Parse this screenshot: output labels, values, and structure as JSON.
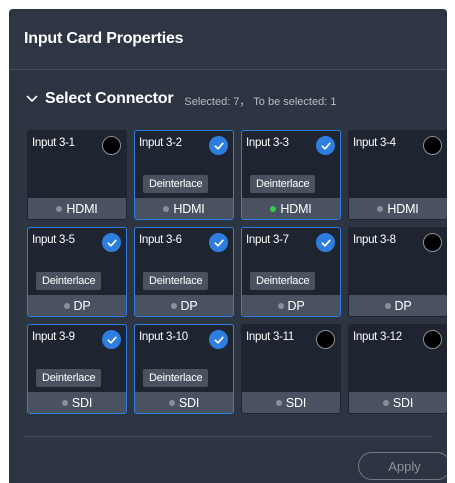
{
  "panel": {
    "title": "Input Card Properties"
  },
  "section": {
    "title": "Select Connector",
    "meta": "Selected: 7， To be selected: 1"
  },
  "colors": {
    "accent": "#2e7de0",
    "active_dot": "#2bd14c",
    "inactive_dot": "#8a909a"
  },
  "cards": [
    {
      "name": "Input 3-1",
      "selected": false,
      "tag": "",
      "type": "HDMI",
      "active": false
    },
    {
      "name": "Input 3-2",
      "selected": true,
      "tag": "Deinterlace",
      "type": "HDMI",
      "active": false
    },
    {
      "name": "Input 3-3",
      "selected": true,
      "tag": "Deinterlace",
      "type": "HDMI",
      "active": true
    },
    {
      "name": "Input 3-4",
      "selected": false,
      "tag": "",
      "type": "HDMI",
      "active": false
    },
    {
      "name": "Input 3-5",
      "selected": true,
      "tag": "Deinterlace",
      "type": "DP",
      "active": false
    },
    {
      "name": "Input 3-6",
      "selected": true,
      "tag": "Deinterlace",
      "type": "DP",
      "active": false
    },
    {
      "name": "Input 3-7",
      "selected": true,
      "tag": "Deinterlace",
      "type": "DP",
      "active": false
    },
    {
      "name": "Input 3-8",
      "selected": false,
      "tag": "",
      "type": "DP",
      "active": false
    },
    {
      "name": "Input 3-9",
      "selected": true,
      "tag": "Deinterlace",
      "type": "SDI",
      "active": false
    },
    {
      "name": "Input 3-10",
      "selected": true,
      "tag": "Deinterlace",
      "type": "SDI",
      "active": false
    },
    {
      "name": "Input 3-11",
      "selected": false,
      "tag": "",
      "type": "SDI",
      "active": false
    },
    {
      "name": "Input 3-12",
      "selected": false,
      "tag": "",
      "type": "SDI",
      "active": false
    }
  ],
  "footer": {
    "apply_label": "Apply"
  }
}
